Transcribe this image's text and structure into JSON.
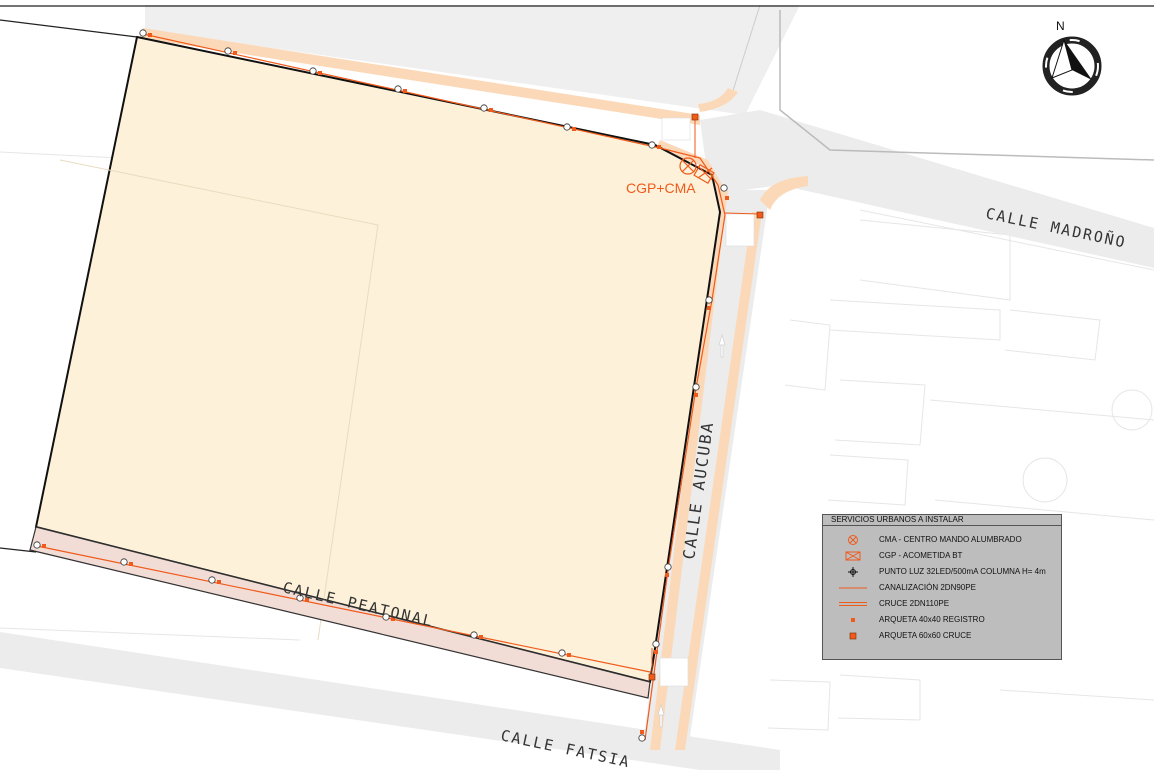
{
  "labels": {
    "cgp_cma": "CGP+CMA",
    "calle_madrono": "CALLE MADROÑO",
    "calle_aucuba": "CALLE AUCUBA",
    "calle_peatonal": "CALLE PEATONAL",
    "calle_fatsia": "CALLE FATSIA",
    "north": "N"
  },
  "legend": {
    "title": "SERVICIOS URBANOS A INSTALAR",
    "items": [
      {
        "symbol": "cma-icon",
        "text": "CMA - CENTRO MANDO ALUMBRADO"
      },
      {
        "symbol": "cgp-icon",
        "text": "CGP - ACOMETIDA BT"
      },
      {
        "symbol": "light-point-icon",
        "text": "PUNTO LUZ 32LED/500mA COLUMNA H= 4m"
      },
      {
        "symbol": "single-line-icon",
        "text": "CANALIZACIÓN 2DN90PE"
      },
      {
        "symbol": "double-line-icon",
        "text": "CRUCE 2DN110PE"
      },
      {
        "symbol": "small-square-icon",
        "text": "ARQUETA 40x40 REGISTRO"
      },
      {
        "symbol": "large-square-icon",
        "text": "ARQUETA 60x60 CRUCE"
      }
    ]
  },
  "colors": {
    "plot_fill": "#fdf1d9",
    "sidewalk": "#fbd9b8",
    "road": "#ececec",
    "network": "#f05a1a",
    "pedestrian": "#f2dcd6"
  }
}
